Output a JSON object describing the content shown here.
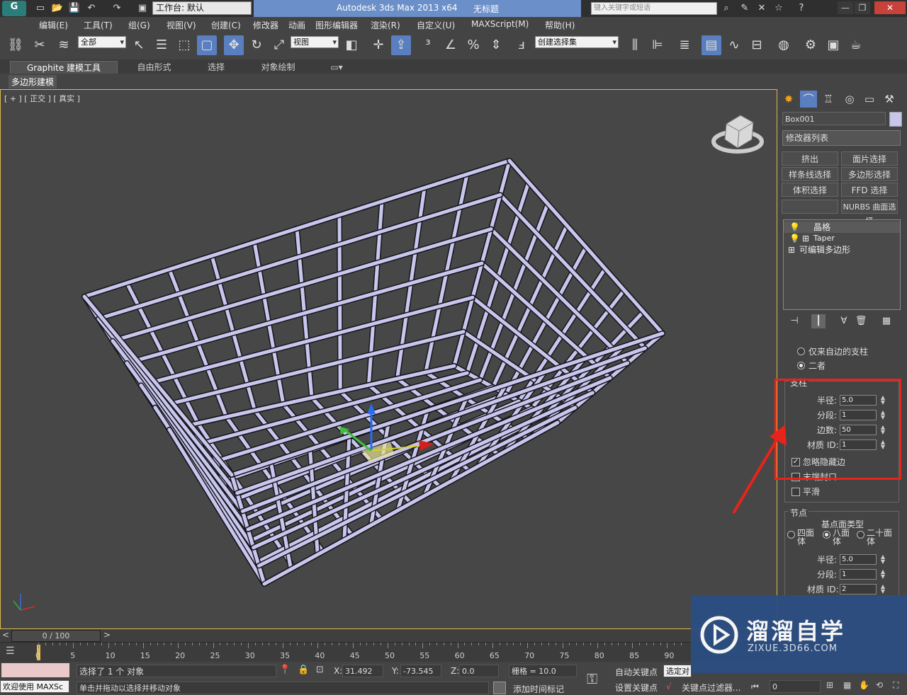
{
  "titlebar": {
    "app_title": "Autodesk 3ds Max  2013 x64",
    "doc_title": "无标题",
    "workspace": "工作台: 默认",
    "search_placeholder": "键入关键字或短语"
  },
  "menu": [
    "编辑(E)",
    "工具(T)",
    "组(G)",
    "视图(V)",
    "创建(C)",
    "修改器",
    "动画",
    "图形编辑器",
    "渲染(R)",
    "自定义(U)",
    "MAXScript(M)",
    "帮助(H)"
  ],
  "toolbar": {
    "selection_filter": "全部",
    "ref_coord": "视图",
    "named_selection": "创建选择集"
  },
  "ribbon": {
    "tabs": [
      "Graphite 建模工具",
      "自由形式",
      "选择",
      "对象绘制"
    ],
    "sub_panel": "多边形建模"
  },
  "viewport": {
    "label": "[ + ] [ 正交 ] [ 真实 ]"
  },
  "command_panel": {
    "object_name": "Box001",
    "object_color": "#c8c6ec",
    "modifier_list": "修改器列表",
    "mod_buttons": [
      "挤出",
      "面片选择",
      "样条线选择",
      "多边形选择",
      "体积选择",
      "FFD 选择",
      "",
      "NURBS 曲面选择"
    ],
    "stack": [
      "晶格",
      "Taper",
      "可编辑多边形"
    ],
    "rollout": {
      "opt1": "仅来自边的支柱",
      "opt2": "二者",
      "struts_title": "支柱",
      "radius_label": "半径:",
      "radius_value": "5.0",
      "segments_label": "分段:",
      "segments_value": "1",
      "sides_label": "边数:",
      "sides_value": "50",
      "matid_label": "材质 ID:",
      "matid_value": "1",
      "ignore_hidden": "忽略隐藏边",
      "end_caps": "末端封口",
      "smooth": "平滑",
      "joints_title": "节点",
      "geodesic_title": "基点面类型",
      "geo_tetra": "四面体",
      "geo_octa": "八面体",
      "geo_icosa": "二十面体",
      "j_radius_value": "5.0",
      "j_segments_value": "1",
      "j_matid_value": "2"
    }
  },
  "timeline": {
    "slider_text": "0 / 100",
    "ticks": [
      "0",
      "5",
      "10",
      "15",
      "20",
      "25",
      "30",
      "35",
      "40",
      "45",
      "50",
      "55",
      "60",
      "65",
      "70",
      "75",
      "80",
      "85",
      "90"
    ]
  },
  "status": {
    "welcome": "欢迎使用 MAXSc",
    "selected": "选择了 1 个 对象",
    "hint": "单击并拖动以选择并移动对象",
    "x_label": "X:",
    "x_value": "31.492",
    "y_label": "Y:",
    "y_value": "-73.545",
    "z_label": "Z:",
    "z_value": "0.0",
    "grid": "栅格 = 10.0",
    "add_time_tag": "添加时间标记",
    "auto_key": "自动关键点",
    "set_key": "设置关键点",
    "selected_obj": "选定对",
    "key_filters": "关键点过滤器...",
    "frame": "0"
  },
  "watermark": {
    "brand": "溜溜自学",
    "url": "ZIXUE.3D66.COM"
  }
}
